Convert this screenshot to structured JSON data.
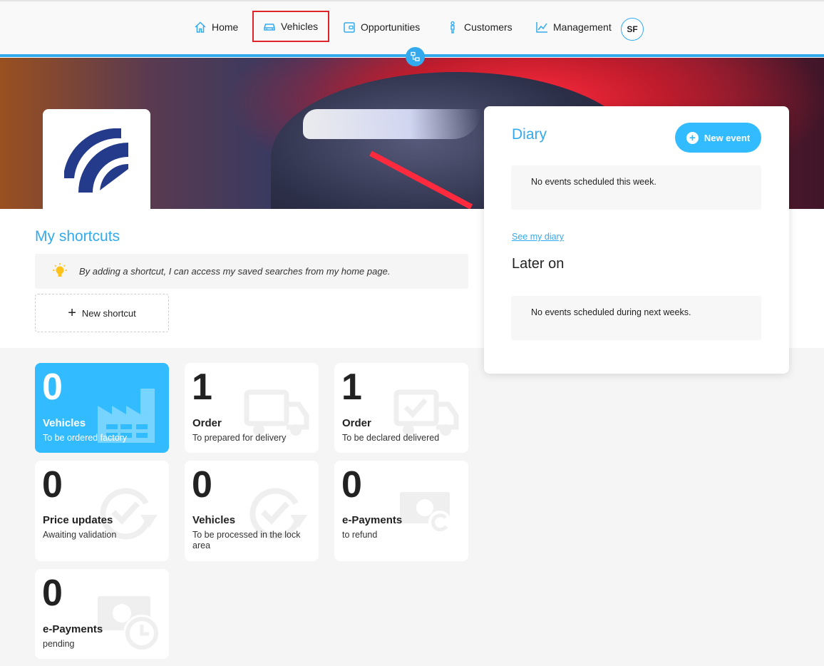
{
  "nav": {
    "items": [
      {
        "label": "Home",
        "icon": "home-icon"
      },
      {
        "label": "Vehicles",
        "icon": "car-icon",
        "selected": true
      },
      {
        "label": "Opportunities",
        "icon": "wallet-icon"
      },
      {
        "label": "Customers",
        "icon": "person-icon"
      },
      {
        "label": "Management",
        "icon": "line-chart-icon"
      }
    ],
    "avatar_initials": "SF"
  },
  "shortcuts": {
    "title": "My shortcuts",
    "tip": "By adding a shortcut, I can access my saved searches from my home page.",
    "new_label": "New shortcut"
  },
  "tiles": [
    {
      "count": "0",
      "title": "Vehicles",
      "subtitle": "To be ordered factory",
      "icon": "factory-icon",
      "active": true
    },
    {
      "count": "1",
      "title": "Order",
      "subtitle": "To prepared for delivery",
      "icon": "truck-icon"
    },
    {
      "count": "1",
      "title": "Order",
      "subtitle": "To be declared delivered",
      "icon": "truck-check-icon"
    },
    {
      "count": "0",
      "title": "Price updates",
      "subtitle": "Awaiting validation",
      "icon": "check-refresh-icon"
    },
    {
      "count": "0",
      "title": "Vehicles",
      "subtitle": "To be processed in the lock area",
      "icon": "check-refresh-icon"
    },
    {
      "count": "0",
      "title": "e-Payments",
      "subtitle": "to refund",
      "icon": "money-refresh-icon"
    },
    {
      "count": "0",
      "title": "e-Payments",
      "subtitle": "pending",
      "icon": "money-clock-icon"
    }
  ],
  "diary": {
    "title": "Diary",
    "new_event_label": "New event",
    "this_week_empty": "No events scheduled this week.",
    "see_link": "See my diary",
    "later_title": "Later on",
    "later_empty": "No events scheduled during next weeks."
  },
  "colors": {
    "accent": "#33aaee",
    "tile_active": "#33bbff",
    "selection_outline": "#e0242c"
  }
}
